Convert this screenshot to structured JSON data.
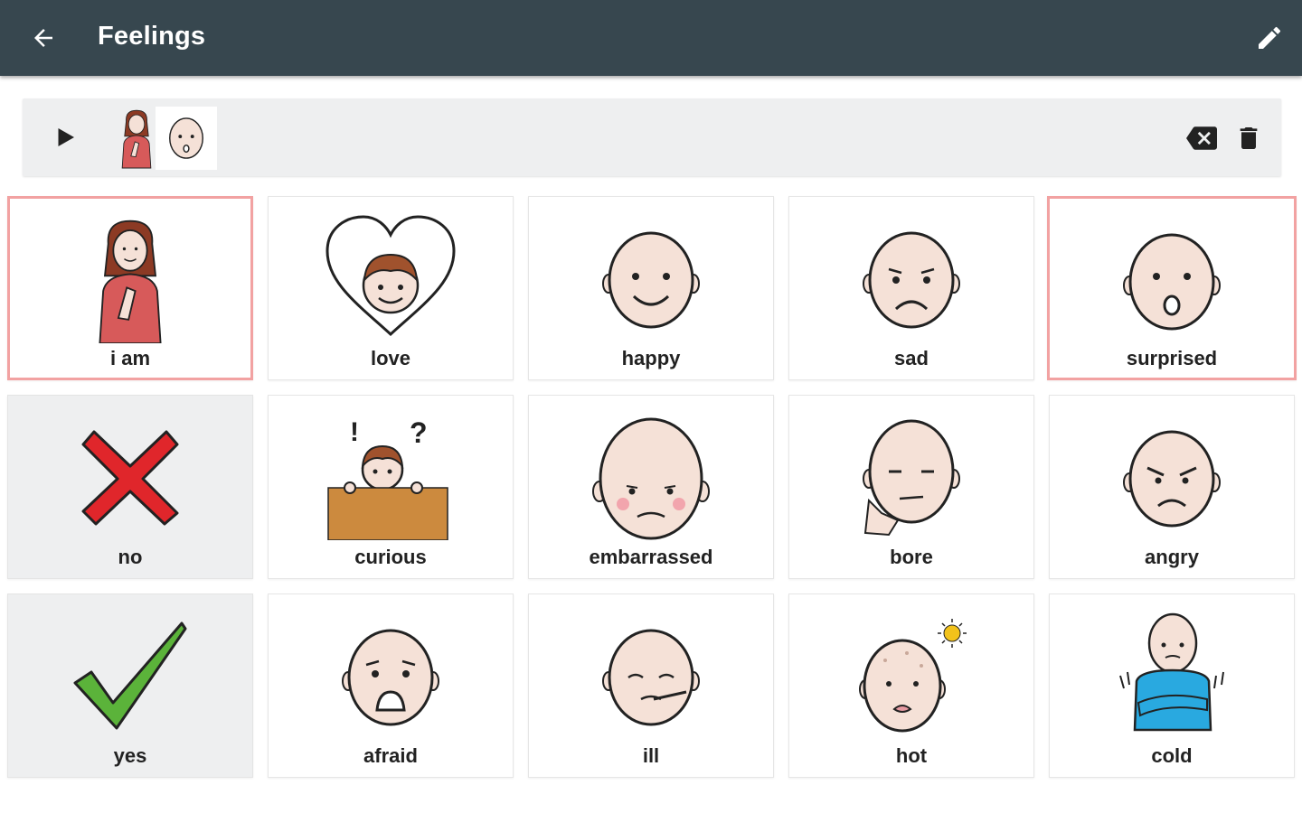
{
  "appbar": {
    "title": "Feelings",
    "back_icon": "arrow-left-icon",
    "edit_icon": "pencil-icon"
  },
  "sentence": {
    "play_icon": "play-icon",
    "chips": [
      "i am",
      "surprised"
    ],
    "backspace_icon": "backspace-icon",
    "clear_icon": "trash-icon"
  },
  "tiles": [
    {
      "label": "i am",
      "icon": "woman-pointing-self-icon",
      "selected": true,
      "gray": false
    },
    {
      "label": "love",
      "icon": "heart-boy-icon",
      "selected": false,
      "gray": false
    },
    {
      "label": "happy",
      "icon": "happy-face-icon",
      "selected": false,
      "gray": false
    },
    {
      "label": "sad",
      "icon": "sad-face-icon",
      "selected": false,
      "gray": false
    },
    {
      "label": "surprised",
      "icon": "surprised-face-icon",
      "selected": true,
      "gray": false
    },
    {
      "label": "no",
      "icon": "red-x-icon",
      "selected": false,
      "gray": true
    },
    {
      "label": "curious",
      "icon": "curious-boy-icon",
      "selected": false,
      "gray": false
    },
    {
      "label": "embarrassed",
      "icon": "embarrassed-face-icon",
      "selected": false,
      "gray": false
    },
    {
      "label": "bore",
      "icon": "bored-face-icon",
      "selected": false,
      "gray": false
    },
    {
      "label": "angry",
      "icon": "angry-face-icon",
      "selected": false,
      "gray": false
    },
    {
      "label": "yes",
      "icon": "green-check-icon",
      "selected": false,
      "gray": true
    },
    {
      "label": "afraid",
      "icon": "afraid-face-icon",
      "selected": false,
      "gray": false
    },
    {
      "label": "ill",
      "icon": "ill-face-icon",
      "selected": false,
      "gray": false
    },
    {
      "label": "hot",
      "icon": "hot-face-icon",
      "selected": false,
      "gray": false
    },
    {
      "label": "cold",
      "icon": "cold-person-icon",
      "selected": false,
      "gray": false
    }
  ],
  "colors": {
    "appbar": "#37474f",
    "selected_border": "#f2a2a2",
    "skin": "#f5e1d7",
    "no_red": "#e0262b",
    "yes_green": "#5bb33a"
  }
}
